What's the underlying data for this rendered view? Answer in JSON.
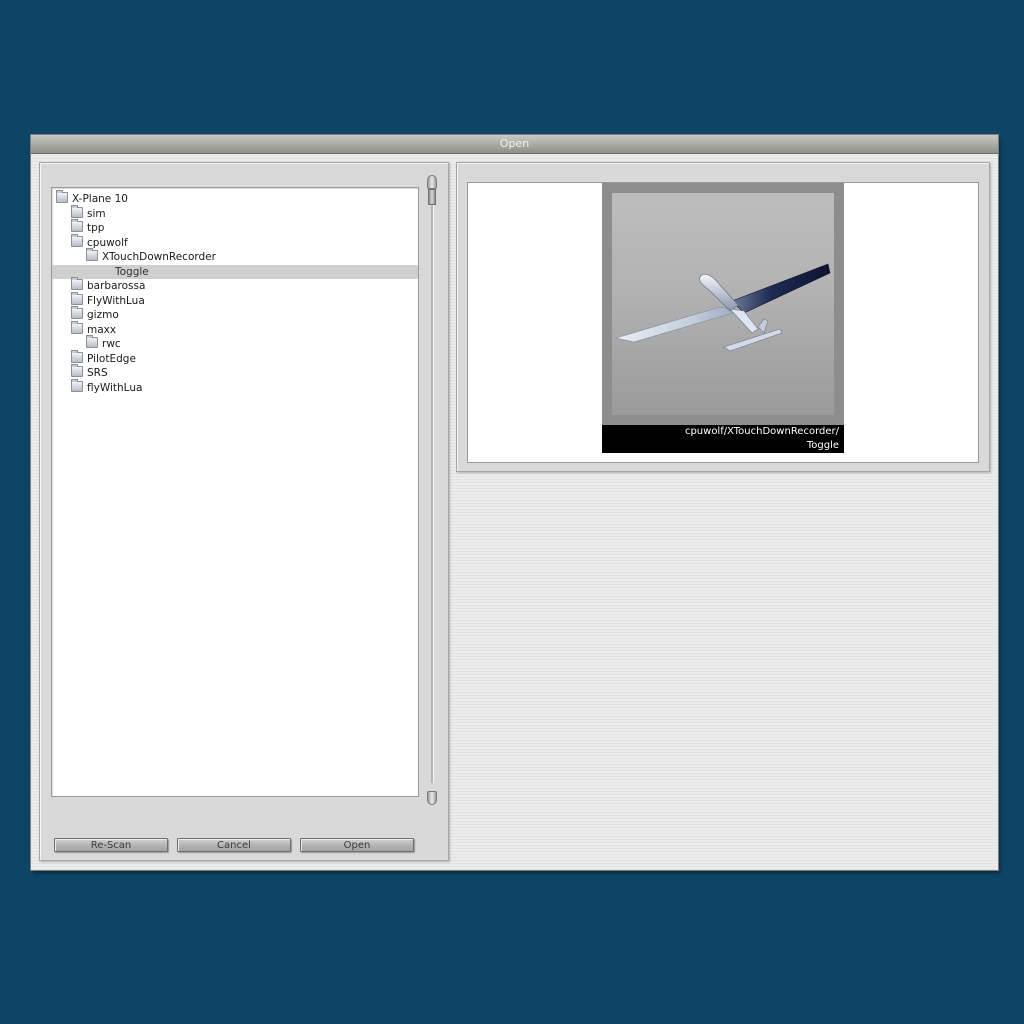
{
  "window": {
    "title": "Open"
  },
  "tree": {
    "items": [
      {
        "label": "X-Plane 10",
        "level": 0,
        "icon": "folder-icon"
      },
      {
        "label": "sim",
        "level": 1,
        "icon": "folder-icon"
      },
      {
        "label": "tpp",
        "level": 1,
        "icon": "folder-icon"
      },
      {
        "label": "cpuwolf",
        "level": 1,
        "icon": "folder-icon"
      },
      {
        "label": "XTouchDownRecorder",
        "level": 2,
        "icon": "folder-icon"
      },
      {
        "label": "Toggle",
        "level": 3,
        "icon": "",
        "selected": true
      },
      {
        "label": "barbarossa",
        "level": 1,
        "icon": "folder-icon"
      },
      {
        "label": "FlyWithLua",
        "level": 1,
        "icon": "folder-icon"
      },
      {
        "label": "gizmo",
        "level": 1,
        "icon": "folder-icon"
      },
      {
        "label": "maxx",
        "level": 1,
        "icon": "folder-icon"
      },
      {
        "label": "rwc",
        "level": 2,
        "icon": "folder-icon"
      },
      {
        "label": "PilotEdge",
        "level": 1,
        "icon": "folder-icon"
      },
      {
        "label": "SRS",
        "level": 1,
        "icon": "folder-icon"
      },
      {
        "label": "flyWithLua",
        "level": 1,
        "icon": "folder-icon"
      }
    ]
  },
  "buttons": {
    "rescan": "Re-Scan",
    "cancel": "Cancel",
    "open": "Open"
  },
  "preview": {
    "caption_line1": "cpuwolf/XTouchDownRecorder/",
    "caption_line2": "Toggle",
    "image": "glider-aircraft-thumbnail"
  },
  "colors": {
    "desktop": "#0e4566",
    "selection": "#cfcfcf"
  }
}
